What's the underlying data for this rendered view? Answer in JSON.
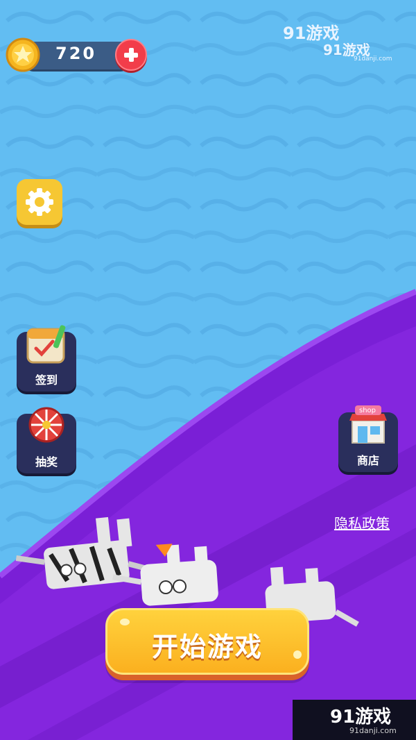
{
  "hud": {
    "coins": "720"
  },
  "menu": {
    "signin_label": "签到",
    "lottery_label": "抽奖",
    "shop_label": "商店",
    "shop_sign": "shop",
    "privacy_label": "隐私政策"
  },
  "start_button": {
    "label": "开始游戏"
  },
  "watermarks": {
    "top_brand": "91游戏",
    "top_brand_url": "91danji.com",
    "bottom_brand": "91游戏",
    "bottom_url": "91danji.com"
  },
  "colors": {
    "water": "#5fb8ef",
    "track": "#7a1fd6",
    "start_button": "#fbb01f",
    "coin_bar": "#3b5c86",
    "plus_button": "#f23d4a"
  }
}
